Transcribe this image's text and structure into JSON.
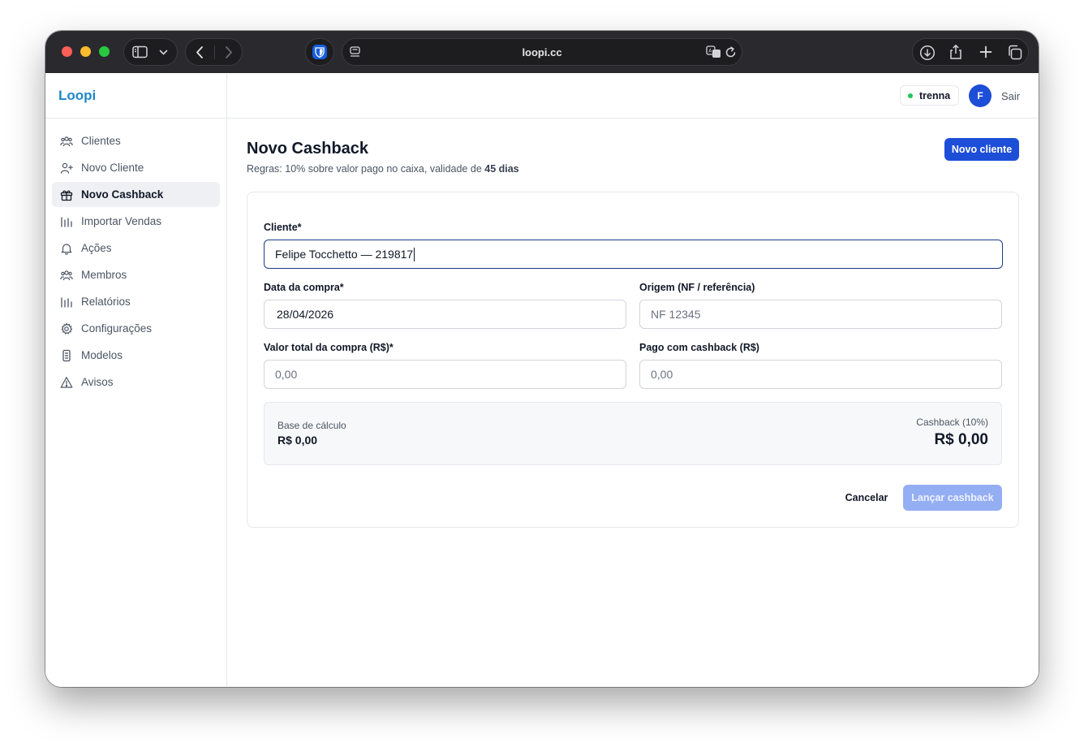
{
  "browser": {
    "url": "loopi.cc",
    "buttons": [
      "sidebar-toggle-icon",
      "chevron-down-icon",
      "back-icon",
      "forward-icon",
      "bitwarden-icon",
      "reader-icon",
      "translate-icon",
      "reload-icon",
      "download-icon",
      "share-icon",
      "new-tab-icon",
      "tab-overview-icon"
    ]
  },
  "app": {
    "brand": "Loopi",
    "brand_color": "#1f87c8",
    "accent_color": "#1d4ed8"
  },
  "sidebar": {
    "items": [
      {
        "label": "Clientes",
        "icon": "users-icon",
        "active": false
      },
      {
        "label": "Novo Cliente",
        "icon": "user-plus-icon",
        "active": false
      },
      {
        "label": "Novo Cashback",
        "icon": "gift-icon",
        "active": true
      },
      {
        "label": "Importar Vendas",
        "icon": "bar-chart-icon",
        "active": false
      },
      {
        "label": "Ações",
        "icon": "bell-icon",
        "active": false
      },
      {
        "label": "Membros",
        "icon": "users-icon",
        "active": false
      },
      {
        "label": "Relatórios",
        "icon": "bar-chart-icon",
        "active": false
      },
      {
        "label": "Configurações",
        "icon": "gear-icon",
        "active": false
      },
      {
        "label": "Modelos",
        "icon": "document-icon",
        "active": false
      },
      {
        "label": "Avisos",
        "icon": "warning-icon",
        "active": false
      }
    ]
  },
  "topbar": {
    "workspace": "trenna",
    "avatar_initial": "F",
    "logout": "Sair"
  },
  "page": {
    "title": "Novo Cashback",
    "rules_prefix": "Regras: 10% sobre valor pago no caixa, validade de ",
    "rules_days": "45 dias",
    "new_client_button": "Novo cliente"
  },
  "form": {
    "cliente": {
      "label": "Cliente*",
      "value": "Felipe Tocchetto — 219817"
    },
    "data_compra": {
      "label": "Data da compra*",
      "value": "28/04/2026"
    },
    "origem": {
      "label": "Origem (NF / referência)",
      "placeholder": "NF 12345"
    },
    "valor_total": {
      "label": "Valor total da compra (R$)*",
      "placeholder": "0,00"
    },
    "pago_cashback": {
      "label": "Pago com cashback (R$)",
      "placeholder": "0,00"
    }
  },
  "summary": {
    "base_label": "Base de cálculo",
    "base_value": "R$ 0,00",
    "cashback_label": "Cashback (10%)",
    "cashback_value": "R$ 0,00"
  },
  "actions": {
    "cancel": "Cancelar",
    "submit": "Lançar cashback"
  }
}
